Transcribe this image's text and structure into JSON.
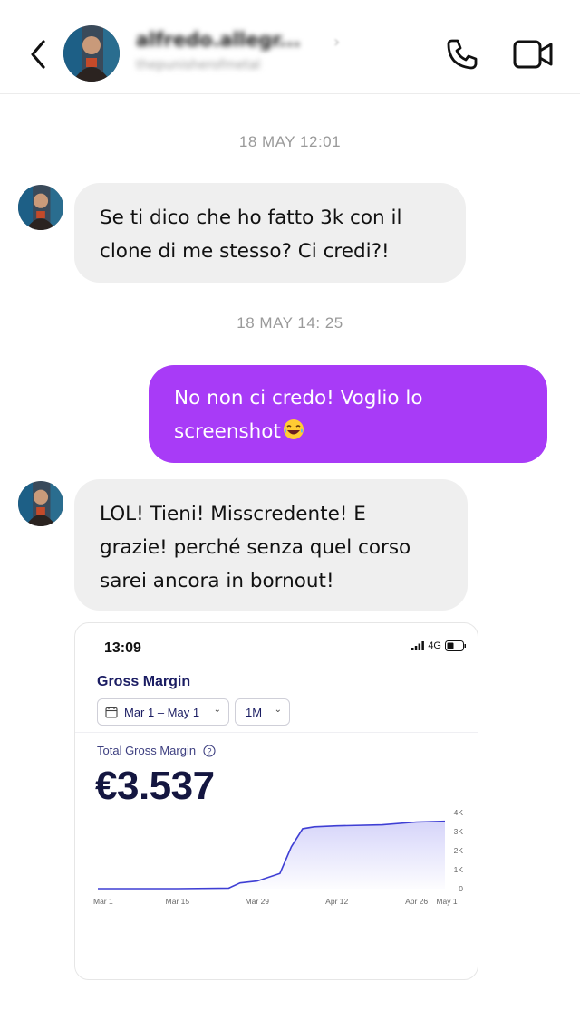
{
  "header": {
    "name": "alfredo.allegr...",
    "handle": "thepunisherofmetal",
    "icons": [
      "back-chevron-icon",
      "phone-icon",
      "video-camera-icon"
    ]
  },
  "messages": {
    "ts1": "18 MAY 12:01",
    "msg1_line1": "Se ti dico che ho fatto 3k con il",
    "msg1_line2": "clone di me stesso? Ci credi?!",
    "ts2": "18 MAY 14: 25",
    "msg2_line1": "No non ci credo! Voglio lo",
    "msg2_line2": "screenshot",
    "msg3_line1": "LOL! Tieni! Misscredente! E",
    "msg3_line2": "grazie! perché senza quel corso",
    "msg3_line3": "sarei ancora in bornout!"
  },
  "screenshot": {
    "time": "13:09",
    "network": "4G",
    "title": "Gross Margin",
    "date_range": "Mar 1 – May 1",
    "period": "1M",
    "metric_label": "Total Gross Margin",
    "metric_value": "€3.537"
  },
  "colors": {
    "outgoing_bubble": "#a83bf7",
    "incoming_bubble": "#efefef",
    "chart_line": "#3f3fd4"
  },
  "chart_data": {
    "type": "area",
    "x_ticks": [
      "Mar 1",
      "Mar 15",
      "Mar 29",
      "Apr 12",
      "Apr 26",
      "May 1"
    ],
    "y_ticks": [
      "4K",
      "3K",
      "2K",
      "1K",
      "0"
    ],
    "ylim": [
      0,
      4000
    ],
    "x": [
      "Mar 1",
      "Mar 15",
      "Mar 24",
      "Mar 26",
      "Mar 29",
      "Apr 2",
      "Apr 4",
      "Apr 6",
      "Apr 8",
      "Apr 12",
      "Apr 20",
      "Apr 26",
      "May 1"
    ],
    "values": [
      0,
      0,
      30,
      300,
      400,
      800,
      2200,
      3150,
      3250,
      3300,
      3350,
      3500,
      3537
    ],
    "grid": false,
    "legend": "none"
  }
}
